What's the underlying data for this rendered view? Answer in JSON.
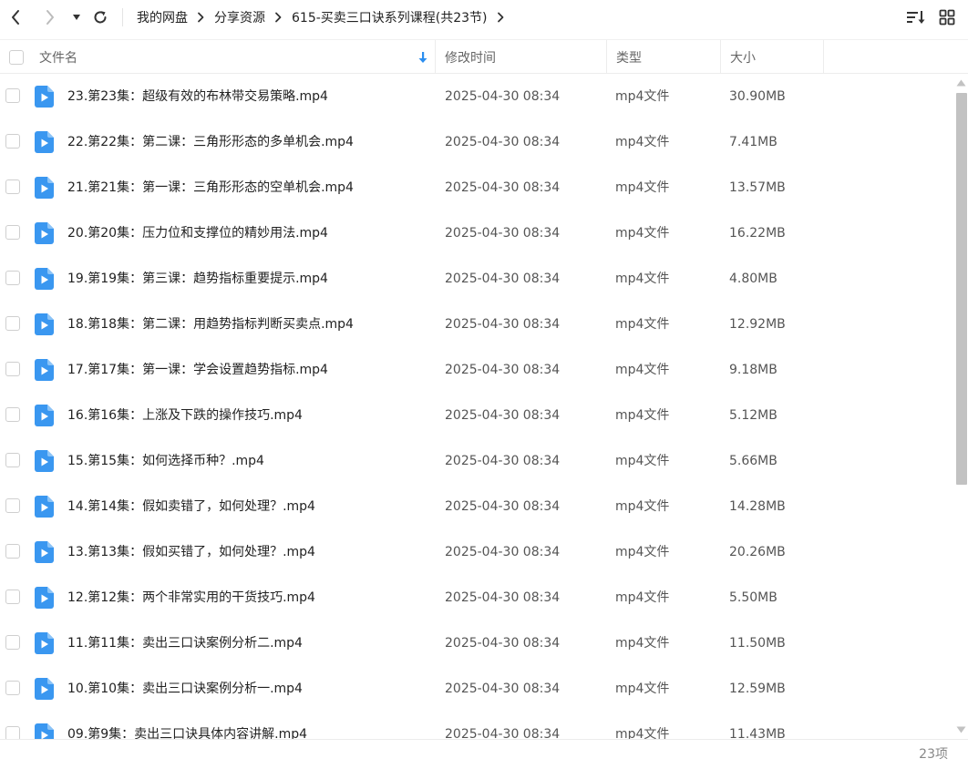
{
  "breadcrumb": {
    "items": [
      "我的网盘",
      "分享资源",
      "615-买卖三口诀系列课程(共23节)"
    ]
  },
  "header": {
    "name": "文件名",
    "modified": "修改时间",
    "type": "类型",
    "size": "大小"
  },
  "icons": {
    "back": "chevron-left-icon",
    "forward": "chevron-right-icon",
    "history": "caret-down-icon",
    "refresh": "refresh-icon",
    "sort": "sort-icon",
    "grid_view": "grid-view-icon",
    "file": "video-file-icon",
    "sort_arrow": "arrow-down-icon"
  },
  "colors": {
    "accent": "#2b8ef0",
    "file_icon": "#3a97f0"
  },
  "files": [
    {
      "name": "23.第23集：超级有效的布林带交易策略.mp4",
      "modified": "2025-04-30 08:34",
      "type": "mp4文件",
      "size": "30.90MB"
    },
    {
      "name": "22.第22集：第二课：三角形形态的多单机会.mp4",
      "modified": "2025-04-30 08:34",
      "type": "mp4文件",
      "size": "7.41MB"
    },
    {
      "name": "21.第21集：第一课：三角形形态的空单机会.mp4",
      "modified": "2025-04-30 08:34",
      "type": "mp4文件",
      "size": "13.57MB"
    },
    {
      "name": "20.第20集：压力位和支撑位的精妙用法.mp4",
      "modified": "2025-04-30 08:34",
      "type": "mp4文件",
      "size": "16.22MB"
    },
    {
      "name": "19.第19集：第三课：趋势指标重要提示.mp4",
      "modified": "2025-04-30 08:34",
      "type": "mp4文件",
      "size": "4.80MB"
    },
    {
      "name": "18.第18集：第二课：用趋势指标判断买卖点.mp4",
      "modified": "2025-04-30 08:34",
      "type": "mp4文件",
      "size": "12.92MB"
    },
    {
      "name": "17.第17集：第一课：学会设置趋势指标.mp4",
      "modified": "2025-04-30 08:34",
      "type": "mp4文件",
      "size": "9.18MB"
    },
    {
      "name": "16.第16集：上涨及下跌的操作技巧.mp4",
      "modified": "2025-04-30 08:34",
      "type": "mp4文件",
      "size": "5.12MB"
    },
    {
      "name": "15.第15集：如何选择币种？.mp4",
      "modified": "2025-04-30 08:34",
      "type": "mp4文件",
      "size": "5.66MB"
    },
    {
      "name": "14.第14集：假如卖错了，如何处理？.mp4",
      "modified": "2025-04-30 08:34",
      "type": "mp4文件",
      "size": "14.28MB"
    },
    {
      "name": "13.第13集：假如买错了，如何处理？.mp4",
      "modified": "2025-04-30 08:34",
      "type": "mp4文件",
      "size": "20.26MB"
    },
    {
      "name": "12.第12集：两个非常实用的干货技巧.mp4",
      "modified": "2025-04-30 08:34",
      "type": "mp4文件",
      "size": "5.50MB"
    },
    {
      "name": "11.第11集：卖出三口诀案例分析二.mp4",
      "modified": "2025-04-30 08:34",
      "type": "mp4文件",
      "size": "11.50MB"
    },
    {
      "name": "10.第10集：卖出三口诀案例分析一.mp4",
      "modified": "2025-04-30 08:34",
      "type": "mp4文件",
      "size": "12.59MB"
    },
    {
      "name": "09.第9集：卖出三口诀具体内容讲解.mp4",
      "modified": "2025-04-30 08:34",
      "type": "mp4文件",
      "size": "11.43MB"
    }
  ],
  "footer": {
    "count": "23项"
  }
}
